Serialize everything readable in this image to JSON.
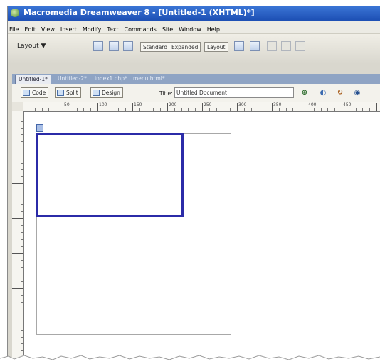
{
  "window": {
    "title": "Macromedia Dreamweaver 8 - [Untitled-1 (XHTML)*]"
  },
  "menubar": {
    "items": [
      "File",
      "Edit",
      "View",
      "Insert",
      "Modify",
      "Text",
      "Commands",
      "Site",
      "Window",
      "Help"
    ]
  },
  "insert_toolbar": {
    "category": "Layout",
    "modes": [
      "Standard",
      "Expanded",
      "Layout"
    ]
  },
  "document_tabs": [
    "Untitled-1*",
    "Untitled-2*",
    "index1.php*",
    "menu.html*"
  ],
  "document_toolbar": {
    "views": [
      "Code",
      "Split",
      "Design"
    ],
    "title_label": "Title:",
    "title_value": "Untitled Document"
  },
  "ruler": {
    "labels": [
      "50",
      "100",
      "150",
      "200",
      "250",
      "300",
      "350",
      "400",
      "450"
    ]
  },
  "colors": {
    "titlebar": "#1d4fb4",
    "ap_div_border": "#2b2ba8"
  }
}
